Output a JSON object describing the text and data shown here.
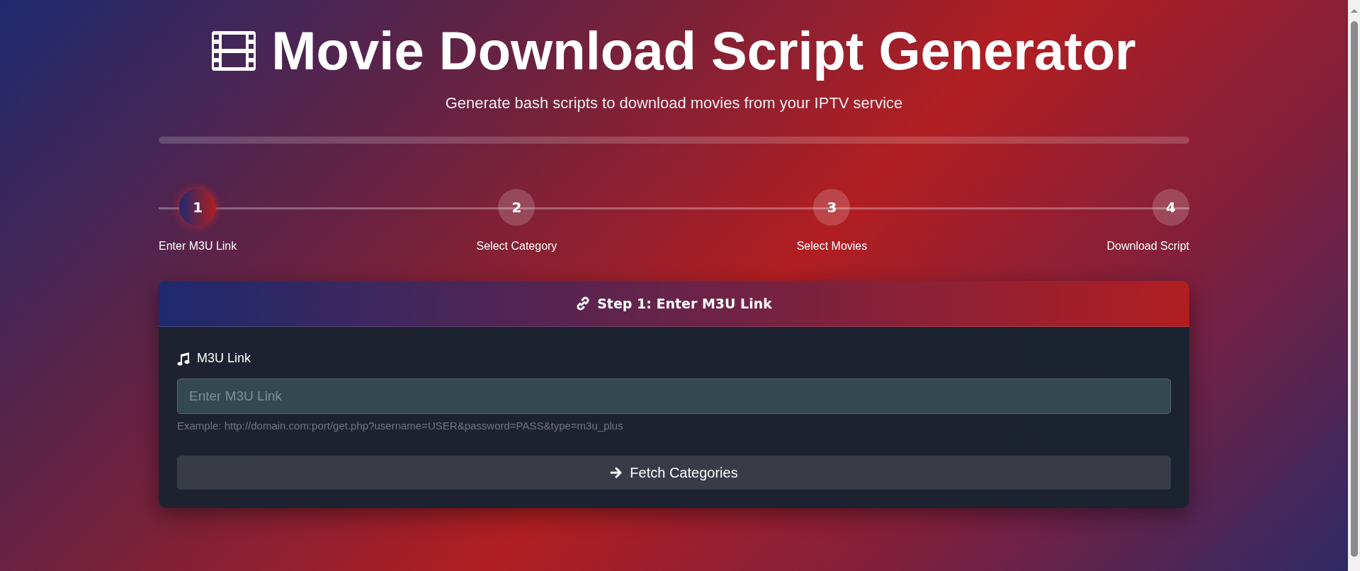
{
  "header": {
    "title": "Movie Download Script Generator",
    "subtitle": "Generate bash scripts to download movies from your IPTV service"
  },
  "progress": {
    "level": 0
  },
  "steps": [
    {
      "number": "1",
      "label": "Enter M3U Link",
      "selected": true
    },
    {
      "number": "2",
      "label": "Select Category",
      "selected": false
    },
    {
      "number": "3",
      "label": "Select Movies",
      "selected": false
    },
    {
      "number": "4",
      "label": "Download Script",
      "selected": false
    }
  ],
  "card": {
    "title": "Step 1: Enter M3U Link",
    "field_label": "M3U Link",
    "placeholder": "Enter M3U Link",
    "hint": "Example: http://domain.com:port/get.php?username=USER&password=PASS&type=m3u_plus",
    "button": "Fetch Categories"
  }
}
